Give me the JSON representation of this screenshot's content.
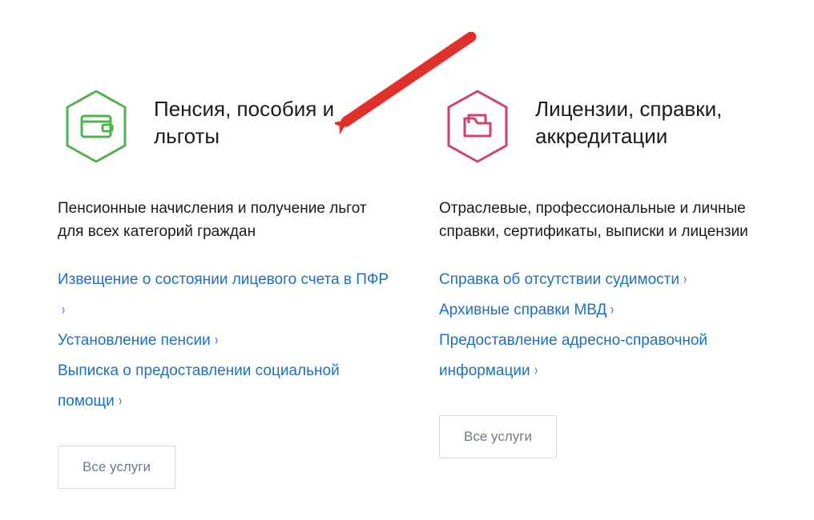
{
  "cards": [
    {
      "title": "Пенсия, пособия и льготы",
      "description": "Пенсионные начисления и получение льгот для всех категорий граждан",
      "links": [
        "Извещение о состоянии лицевого счета в ПФР",
        "Установление пенсии",
        "Выписка о предоставлении социальной помощи"
      ],
      "all_button": "Все услуги",
      "icon": "wallet-icon",
      "icon_color": "#4fb34f"
    },
    {
      "title": "Лицензии, справки, аккредитации",
      "description": "Отраслевые, профессиональные и личные справки, сертификаты, выписки и лицензии",
      "links": [
        "Справка об отсутствии судимости",
        "Архивные справки МВД",
        "Предоставление адресно-справочной информации"
      ],
      "all_button": "Все услуги",
      "icon": "folder-icon",
      "icon_color": "#d0426b"
    }
  ],
  "annotation": {
    "type": "arrow",
    "color": "#e1302a"
  }
}
